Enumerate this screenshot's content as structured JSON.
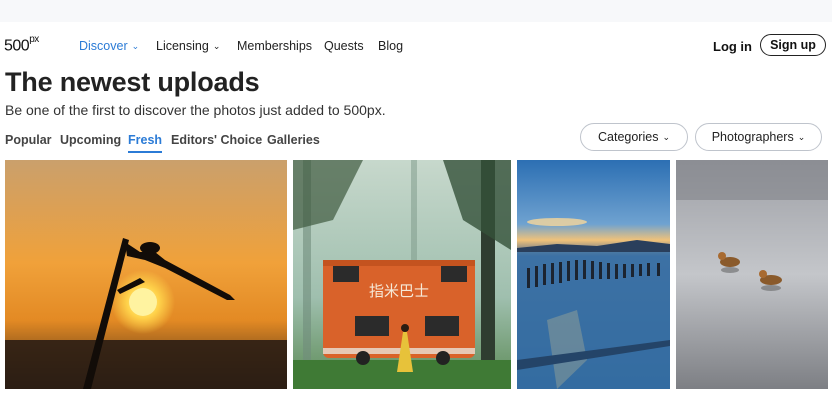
{
  "logo": {
    "text": "500",
    "sup": "px"
  },
  "nav": {
    "discover": "Discover",
    "licensing": "Licensing",
    "memberships": "Memberships",
    "quests": "Quests",
    "blog": "Blog",
    "login": "Log in",
    "signup": "Sign up"
  },
  "header": {
    "title": "The newest uploads",
    "subtitle": "Be one of the first to discover the photos just added to 500px."
  },
  "tabs": [
    "Popular",
    "Upcoming",
    "Fresh",
    "Editors' Choice",
    "Galleries"
  ],
  "active_tab": "Fresh",
  "filters": {
    "categories": "Categories",
    "photographers": "Photographers"
  },
  "colors": {
    "accent": "#2b7bd6"
  },
  "photos": [
    {
      "subject": "dragonfly-silhouette-sunset"
    },
    {
      "subject": "orange-double-decker-bus-forest",
      "sign_text": "指米巴士"
    },
    {
      "subject": "sea-pier-posts-dusk"
    },
    {
      "subject": "ducks-on-water"
    }
  ]
}
